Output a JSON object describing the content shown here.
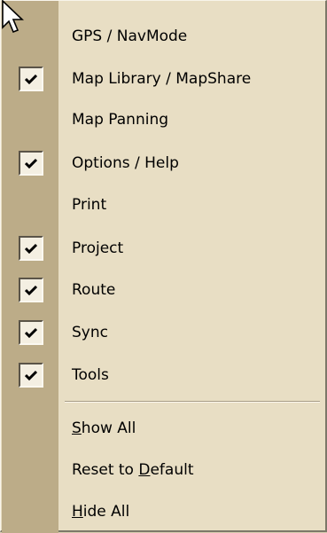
{
  "menu": {
    "items": [
      {
        "label": "GPS / NavMode",
        "checked": false
      },
      {
        "label": "Map Library / MapShare",
        "checked": true
      },
      {
        "label": "Map Panning",
        "checked": false
      },
      {
        "label": "Options / Help",
        "checked": true
      },
      {
        "label": "Print",
        "checked": false
      },
      {
        "label": "Project",
        "checked": true
      },
      {
        "label": "Route",
        "checked": true
      },
      {
        "label": "Sync",
        "checked": true
      },
      {
        "label": "Tools",
        "checked": true
      }
    ],
    "actions": {
      "show_all": {
        "mnemonic": "S",
        "rest": "how All"
      },
      "reset_to_default": {
        "before": "Reset to ",
        "mnemonic": "D",
        "after": "efault"
      },
      "hide_all": {
        "mnemonic": "H",
        "rest": "ide All"
      }
    }
  },
  "icons": {
    "pointer": "mouse-pointer-icon",
    "check": "checkmark-icon"
  },
  "colors": {
    "menu_background": "#e8dec4",
    "gutter": "#bcac88",
    "text": "#000000"
  }
}
